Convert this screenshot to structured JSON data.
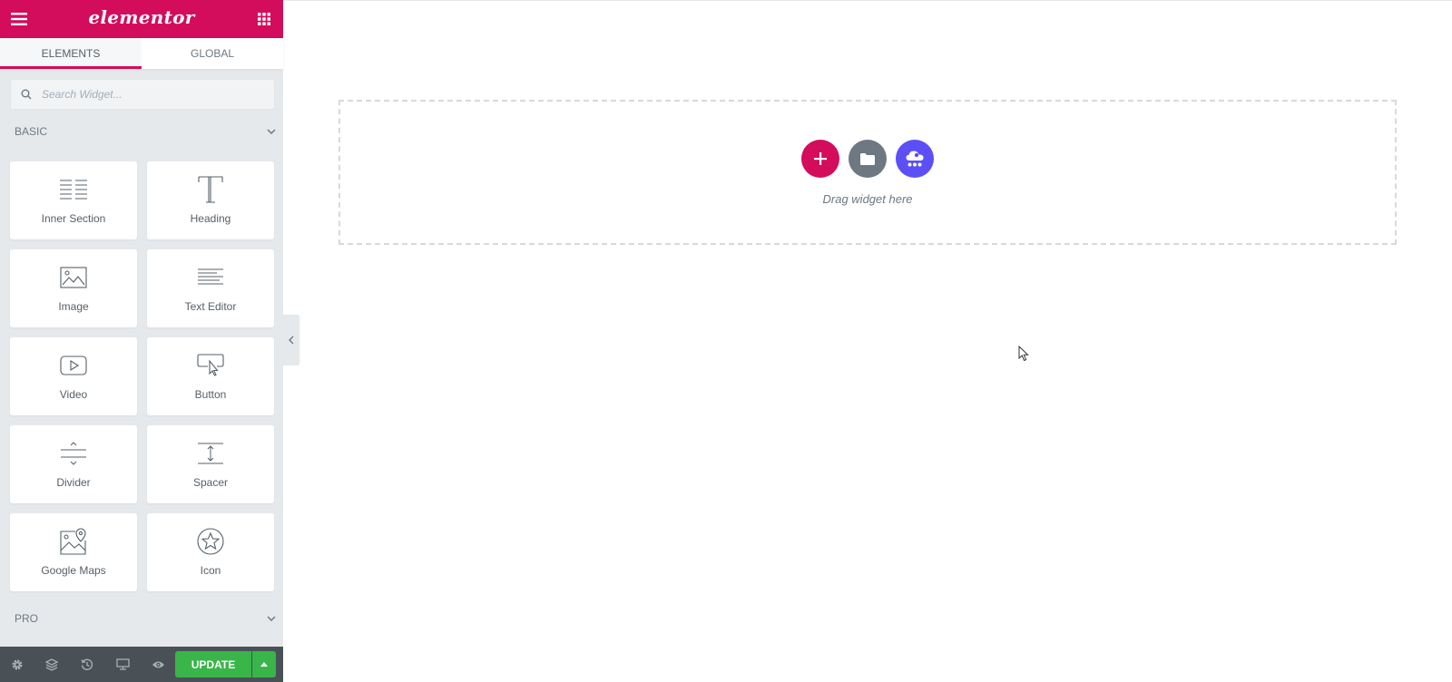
{
  "header": {
    "logo": "elementor",
    "menu_icon": "hamburger-icon",
    "apps_icon": "grid-icon"
  },
  "tabs": [
    {
      "label": "ELEMENTS",
      "active": true
    },
    {
      "label": "GLOBAL",
      "active": false
    }
  ],
  "search": {
    "placeholder": "Search Widget..."
  },
  "sections": {
    "basic": "BASIC",
    "pro": "PRO"
  },
  "widgets": [
    {
      "label": "Inner Section",
      "icon": "inner-section-icon"
    },
    {
      "label": "Heading",
      "icon": "heading-icon"
    },
    {
      "label": "Image",
      "icon": "image-icon"
    },
    {
      "label": "Text Editor",
      "icon": "text-editor-icon"
    },
    {
      "label": "Video",
      "icon": "video-icon"
    },
    {
      "label": "Button",
      "icon": "button-icon"
    },
    {
      "label": "Divider",
      "icon": "divider-icon"
    },
    {
      "label": "Spacer",
      "icon": "spacer-icon"
    },
    {
      "label": "Google Maps",
      "icon": "google-maps-icon"
    },
    {
      "label": "Icon",
      "icon": "star-icon"
    }
  ],
  "footer": {
    "update_label": "UPDATE"
  },
  "canvas": {
    "drop_text": "Drag widget here"
  },
  "colors": {
    "brand": "#d30c5c",
    "panel_bg": "#e6e9ec",
    "footer_bg": "#495157",
    "update": "#39b54a",
    "template": "#6d7882",
    "kit": "#5b4ff5"
  }
}
